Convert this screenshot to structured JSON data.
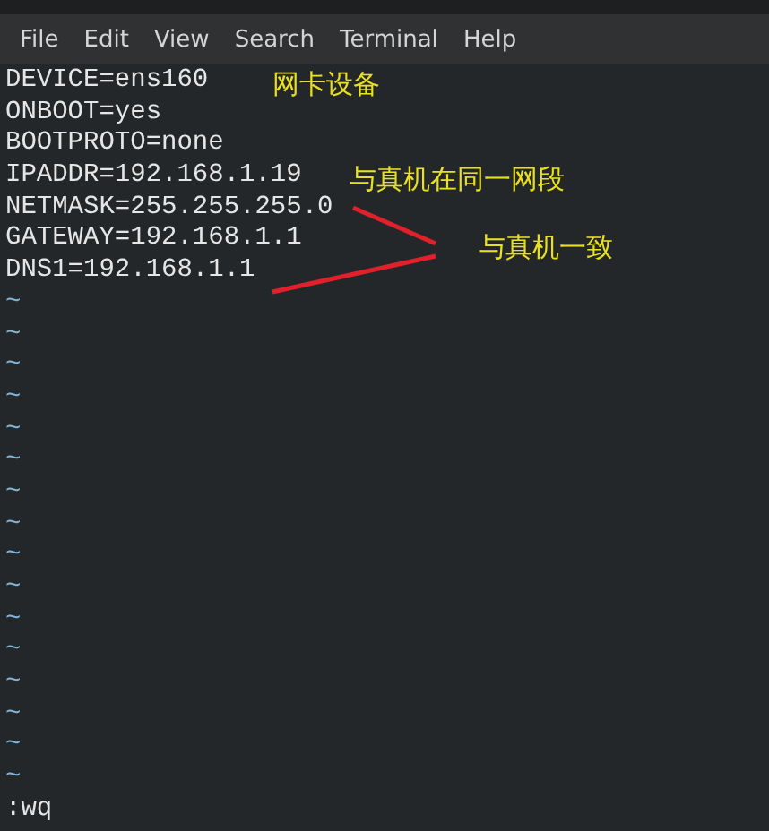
{
  "menu_bar": {
    "items": [
      "File",
      "Edit",
      "View",
      "Search",
      "Terminal",
      "Help"
    ]
  },
  "editor": {
    "lines": [
      "DEVICE=ens160",
      "ONBOOT=yes",
      "BOOTPROTO=none",
      "IPADDR=192.168.1.19",
      "NETMASK=255.255.255.0",
      "GATEWAY=192.168.1.1",
      "DNS1=192.168.1.1"
    ],
    "empty_line_markers": [
      "~",
      "~",
      "~",
      "~",
      "~",
      "~",
      "~",
      "~",
      "~",
      "~",
      "~",
      "~",
      "~",
      "~",
      "~",
      "~"
    ],
    "command_line": ":wq"
  },
  "annotations": [
    "网卡设备",
    "与真机在同一网段",
    "与真机一致"
  ]
}
